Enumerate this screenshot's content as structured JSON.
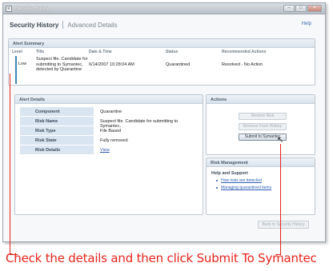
{
  "window": {
    "title": "Security History"
  },
  "header": {
    "title": "Security History",
    "subtitle": "Advanced Details",
    "help": "Help"
  },
  "summary": {
    "heading": "Alert Summary",
    "columns": [
      "Level",
      "Title",
      "Date & Time",
      "Status",
      "Recommended Actions"
    ],
    "row": {
      "level": "Low",
      "title": "Suspect file. Candidate for submitting to Symantec, detected by Quarantine",
      "datetime": "6/14/2007 10:28:04 AM",
      "status": "Quarantined",
      "action": "Resolved - No Action"
    }
  },
  "details": {
    "heading": "Alert Details",
    "rows": [
      {
        "key": "Component",
        "value": "Quarantine"
      },
      {
        "key": "Risk Name",
        "value": "Suspect file. Candidate for submitting to Symantec."
      },
      {
        "key": "Risk Type",
        "value": "File Based"
      },
      {
        "key": "Risk State",
        "value": "Fully removed"
      },
      {
        "key": "Risk Details",
        "value": "View"
      }
    ]
  },
  "actions": {
    "heading": "Actions",
    "restore": "Restore Risk",
    "remove": "Remove From History",
    "submit": "Submit to Symantec"
  },
  "risk_management": {
    "heading": "Risk Management",
    "subheading": "Help and Support",
    "links": [
      "How risks are detected",
      "Managing quarantined items"
    ]
  },
  "back_button": "Back to Security History",
  "caption": "Check the details and then click Submit To Symantec",
  "colors": {
    "annotation": "#e8231c",
    "accent": "#3f86b8",
    "link": "#2d5fb3"
  }
}
